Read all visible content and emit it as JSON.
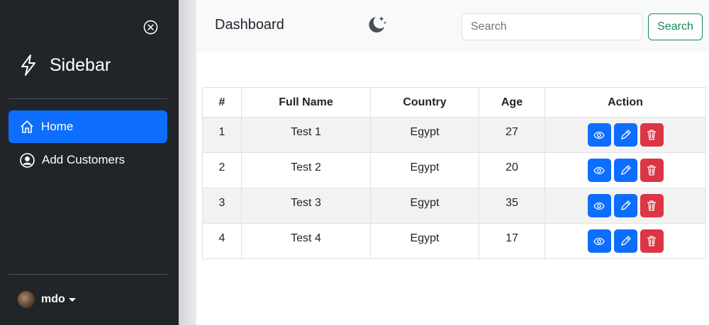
{
  "sidebar": {
    "brand": "Sidebar",
    "items": [
      {
        "label": "Home",
        "icon": "house-icon",
        "active": true
      },
      {
        "label": "Add Customers",
        "icon": "person-circle-icon"
      }
    ],
    "user": "mdo"
  },
  "header": {
    "title": "Dashboard",
    "search_placeholder": "Search",
    "search_button": "Search"
  },
  "table": {
    "columns": [
      "#",
      "Full Name",
      "Country",
      "Age",
      "Action"
    ],
    "rows": [
      {
        "id": "1",
        "name": "Test 1",
        "country": "Egypt",
        "age": "27"
      },
      {
        "id": "2",
        "name": "Test 2",
        "country": "Egypt",
        "age": "20"
      },
      {
        "id": "3",
        "name": "Test 3",
        "country": "Egypt",
        "age": "35"
      },
      {
        "id": "4",
        "name": "Test 4",
        "country": "Egypt",
        "age": "17"
      }
    ]
  },
  "colors": {
    "sidebar": "#212529",
    "primary": "#0d6efd",
    "danger": "#dc3545",
    "success": "#198754"
  }
}
